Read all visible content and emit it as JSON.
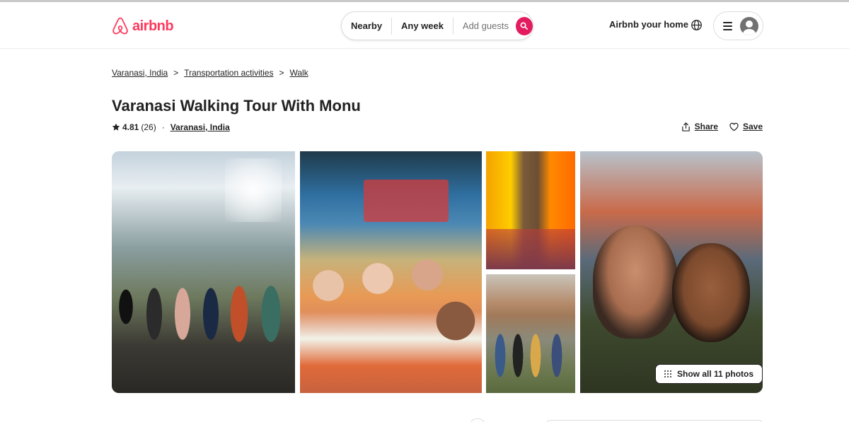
{
  "brand": {
    "name": "airbnb",
    "color": "#ff385c"
  },
  "search": {
    "location": "Nearby",
    "dates": "Any week",
    "guests_placeholder": "Add guests",
    "search_icon": "search-icon",
    "button_color": "#e31c5f"
  },
  "header": {
    "host_link": "Airbnb your home",
    "globe_icon": "globe-icon",
    "menu_icon": "menu-icon",
    "avatar_icon": "avatar-icon"
  },
  "breadcrumb": {
    "items": [
      "Varanasi, India",
      "Transportation activities",
      "Walk"
    ],
    "separator": ">"
  },
  "listing": {
    "title": "Varanasi Walking Tour With Monu",
    "rating": "4.81",
    "reviews": "(26)",
    "dot": "·",
    "location": "Varanasi, India"
  },
  "actions": {
    "share": "Share",
    "save": "Save",
    "share_icon": "share-icon",
    "save_icon": "heart-icon"
  },
  "photos": {
    "show_all": "Show all 11 photos",
    "count": 5
  }
}
